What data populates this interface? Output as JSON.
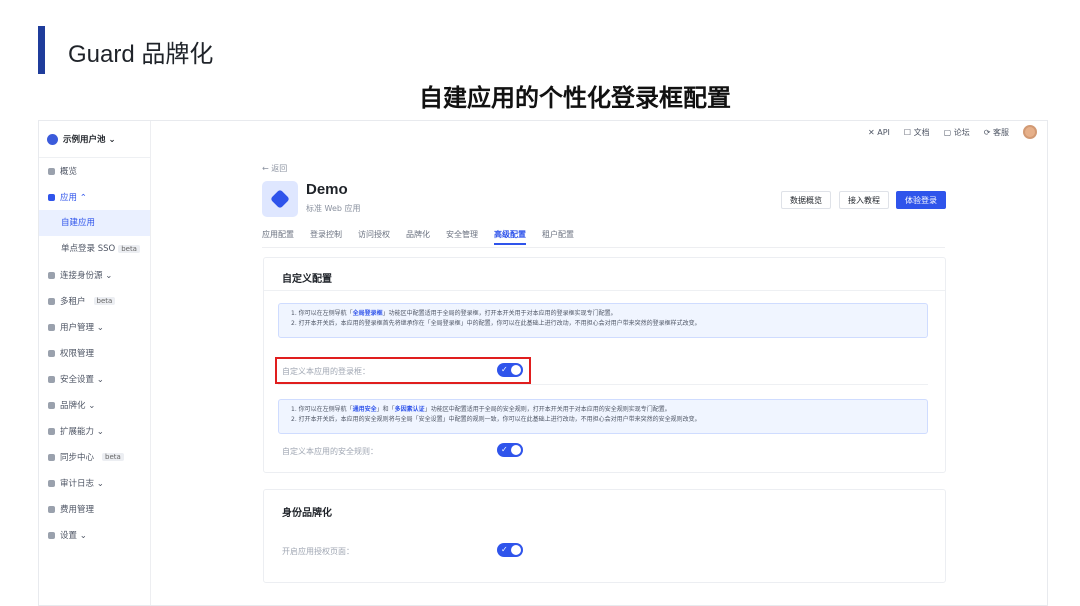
{
  "slide": {
    "title": "Guard 品牌化",
    "headline": "自建应用的个性化登录框配置"
  },
  "colors": {
    "accent": "#1f3c9b",
    "primary": "#2f54eb",
    "highlight": "#e01e1e"
  },
  "sidebar": {
    "pool_name": "示例用户池 ⌄",
    "items": [
      {
        "label": "概览",
        "icon": "dashboard-icon"
      },
      {
        "label": "应用 ⌃",
        "icon": "apps-icon"
      },
      {
        "label": "自建应用"
      },
      {
        "label": "单点登录 SSO",
        "badge": "beta"
      },
      {
        "label": "连接身份源 ⌄",
        "icon": "share-icon"
      },
      {
        "label": "多租户",
        "badge": "beta",
        "icon": "tenant-icon"
      },
      {
        "label": "用户管理 ⌄",
        "icon": "users-icon"
      },
      {
        "label": "权限管理",
        "icon": "lock-icon"
      },
      {
        "label": "安全设置 ⌄",
        "icon": "shield-icon"
      },
      {
        "label": "品牌化 ⌄",
        "icon": "brush-icon"
      },
      {
        "label": "扩展能力 ⌄",
        "icon": "extend-icon"
      },
      {
        "label": "同步中心",
        "badge": "beta",
        "icon": "sync-icon"
      },
      {
        "label": "审计日志 ⌄",
        "icon": "log-icon"
      },
      {
        "label": "费用管理",
        "icon": "billing-icon"
      },
      {
        "label": "设置 ⌄",
        "icon": "gear-icon"
      }
    ]
  },
  "topbar": {
    "api": "✕ API",
    "docs": "☐ 文档",
    "forum": "▢ 论坛",
    "support": "⟳ 客服"
  },
  "app": {
    "back": "← 返回",
    "name": "Demo",
    "type": "标准 Web 应用",
    "btn_overview": "数据概览",
    "btn_tutorial": "接入教程",
    "btn_try": "体验登录"
  },
  "tabs": [
    "应用配置",
    "登录控制",
    "访问授权",
    "品牌化",
    "安全管理",
    "高级配置",
    "租户配置"
  ],
  "custom_config": {
    "title": "自定义配置",
    "notice1_line1_pre": "1. 你可以在左侧导航「",
    "notice1_line1_hl": "全局登录框",
    "notice1_line1_post": "」功能区中配置适用于全局的登录框，打开本开关用于对本应用的登录框实现专门配置。",
    "notice1_line2": "2. 打开本开关后，本应用的登录框首先将继承你在「全局登录框」中的配置，你可以在此基础上进行改动，不用担心会对用户带来突然的登录框样式改变。",
    "field1_label": "自定义本应用的登录框：",
    "notice2_line1_pre": "1. 你可以在左侧导航「",
    "notice2_line1_hl1": "通用安全",
    "notice2_line1_mid": "」和「",
    "notice2_line1_hl2": "多因素认证",
    "notice2_line1_post": "」功能区中配置适用于全局的安全规则，打开本开关用于对本应用的安全规则实现专门配置。",
    "notice2_line2": "2. 打开本开关后，本应用的安全规则将与全局「安全设置」中配置的规则一致，你可以在此基础上进行改动，不用担心会对用户带来突然的安全规则改变。",
    "field2_label": "自定义本应用的安全规则："
  },
  "identity_brand": {
    "title": "身份品牌化",
    "field_label": "开启应用授权页面："
  },
  "toggles": {
    "custom_login": true,
    "custom_security": true,
    "auth_page": true
  }
}
